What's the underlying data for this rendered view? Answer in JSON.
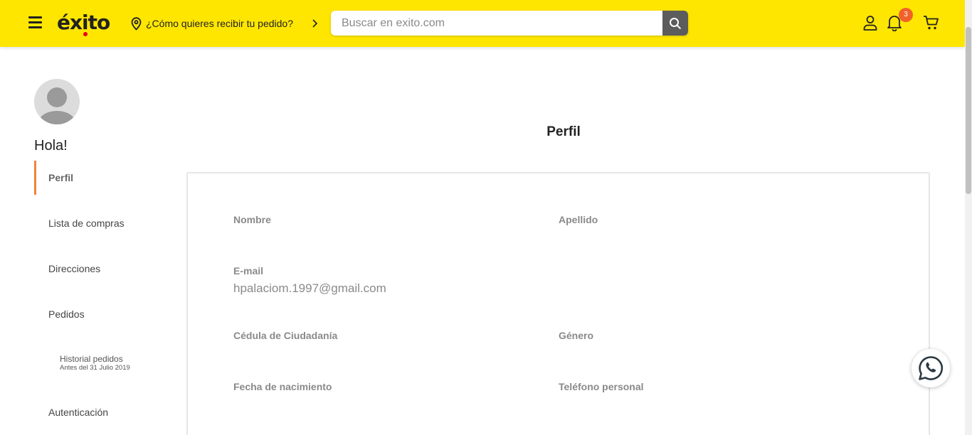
{
  "header": {
    "logo_text": "éxito",
    "delivery_prompt": "¿Cómo quieres recibir tu pedido?",
    "search": {
      "placeholder": "Buscar en exito.com",
      "value": ""
    },
    "notifications_count": "3",
    "icons": [
      "menu-icon",
      "location-pin-icon",
      "chevron-right-icon",
      "search-icon",
      "user-icon",
      "bell-icon",
      "cart-icon"
    ],
    "brand_color": "#ffe600",
    "badge_color": "#f0622a"
  },
  "sidebar": {
    "greeting": "Hola!",
    "accent_color": "#f0843c",
    "items": [
      {
        "label": "Perfil",
        "active": true
      },
      {
        "label": "Lista de compras"
      },
      {
        "label": "Direcciones"
      },
      {
        "label": "Pedidos"
      },
      {
        "label": "Historial pedidos",
        "sublabel": "Antes del 31 Julio 2019"
      },
      {
        "label": "Autenticación"
      }
    ]
  },
  "main": {
    "title": "Perfil",
    "fields": {
      "nombre": {
        "label": "Nombre",
        "value": ""
      },
      "apellido": {
        "label": "Apellido",
        "value": ""
      },
      "email": {
        "label": "E-mail",
        "value": "hpalaciom.1997@gmail.com"
      },
      "cedula": {
        "label": "Cédula de Ciudadanía",
        "value": ""
      },
      "genero": {
        "label": "Género",
        "value": ""
      },
      "fecha_nacimiento": {
        "label": "Fecha de nacimiento",
        "value": ""
      },
      "telefono": {
        "label": "Teléfono personal",
        "value": ""
      }
    }
  },
  "floating": {
    "icon": "whatsapp-icon"
  }
}
